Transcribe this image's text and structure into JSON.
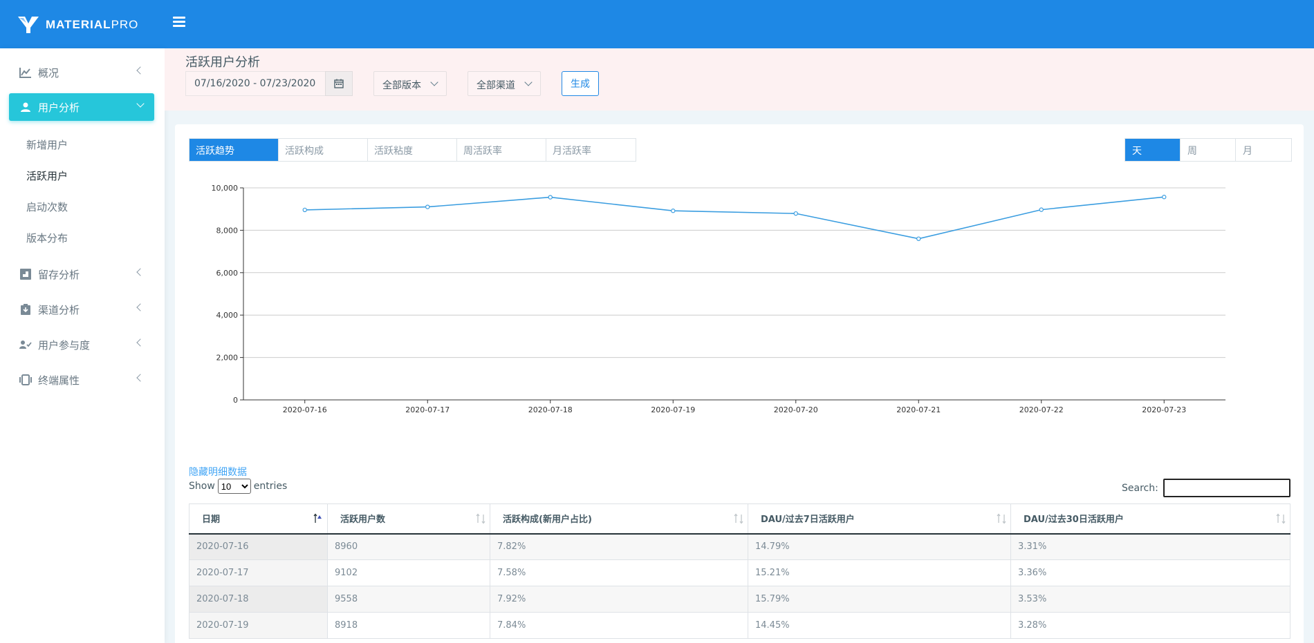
{
  "brand": {
    "bold": "MATERIAL",
    "thin": "PRO"
  },
  "sidebar": {
    "items": [
      {
        "label": "概况",
        "icon": "line-chart-icon"
      },
      {
        "label": "用户分析",
        "icon": "user-icon",
        "active": true
      },
      {
        "label": "留存分析",
        "icon": "retention-icon"
      },
      {
        "label": "渠道分析",
        "icon": "channel-icon"
      },
      {
        "label": "用户参与度",
        "icon": "user-check-icon"
      },
      {
        "label": "终端属性",
        "icon": "device-icon"
      }
    ],
    "sub_items": [
      "新增用户",
      "活跃用户",
      "启动次数",
      "版本分布"
    ]
  },
  "filters": {
    "page_title": "活跃用户分析",
    "date_range": "07/16/2020 - 07/23/2020",
    "version": "全部版本",
    "channel": "全部渠道",
    "generate": "生成"
  },
  "tabs": [
    "活跃趋势",
    "活跃构成",
    "活跃粘度",
    "周活跃率",
    "月活跃率"
  ],
  "periods": [
    "天",
    "周",
    "月"
  ],
  "chart_data": {
    "type": "line",
    "x": [
      "2020-07-16",
      "2020-07-17",
      "2020-07-18",
      "2020-07-19",
      "2020-07-20",
      "2020-07-21",
      "2020-07-22",
      "2020-07-23"
    ],
    "values": [
      8960,
      9102,
      9558,
      8918,
      8790,
      7600,
      8970,
      9570
    ],
    "ylim": [
      0,
      10000
    ],
    "yticks": [
      "0",
      "2,000",
      "4,000",
      "6,000",
      "8,000",
      "10,000"
    ],
    "grid": true,
    "color": "#3a9de0"
  },
  "table": {
    "toggle_link": "隐藏明细数据",
    "show": "Show",
    "page_size": "10",
    "entries": "entries",
    "search": "Search:",
    "headers": [
      "日期",
      "活跃用户数",
      "活跃构成(新用户占比)",
      "DAU/过去7日活跃用户",
      "DAU/过去30日活跃用户"
    ],
    "rows": [
      [
        "2020-07-16",
        "8960",
        "7.82%",
        "14.79%",
        "3.31%"
      ],
      [
        "2020-07-17",
        "9102",
        "7.58%",
        "15.21%",
        "3.36%"
      ],
      [
        "2020-07-18",
        "9558",
        "7.92%",
        "15.79%",
        "3.53%"
      ],
      [
        "2020-07-19",
        "8918",
        "7.84%",
        "14.45%",
        "3.28%"
      ]
    ]
  }
}
